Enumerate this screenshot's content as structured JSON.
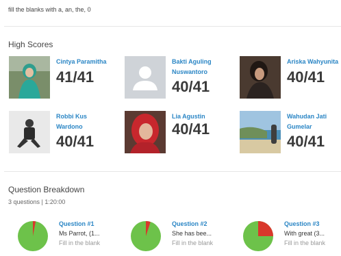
{
  "instructions": "fill the blanks with a, an, the, 0",
  "high_scores": {
    "title": "High Scores",
    "players": [
      {
        "name": "Cintya Paramitha",
        "score": "41/41",
        "avatar": "photo-girl-hijab-green-icon"
      },
      {
        "name": "Bakti Aguling\nNuswantoro",
        "score": "40/41",
        "avatar": "default-user-icon"
      },
      {
        "name": "Ariska Wahyunita",
        "score": "40/41",
        "avatar": "photo-girl-dark-icon"
      },
      {
        "name": "Robbi Kus\nWardono",
        "score": "40/41",
        "avatar": "photo-boy-sitting-icon"
      },
      {
        "name": "Lia Agustin",
        "score": "40/41",
        "avatar": "photo-girl-red-hijab-icon"
      },
      {
        "name": "Wahudan Jati\nGumelar",
        "score": "40/41",
        "avatar": "photo-beach-icon"
      }
    ]
  },
  "breakdown": {
    "title": "Question Breakdown",
    "subtitle": "3 questions | 1:20:00",
    "questions": [
      {
        "label": "Question #1",
        "text": "Ms Parrot, (1...",
        "type": "Fill in the blank",
        "correct_fraction": 0.97
      },
      {
        "label": "Question #2",
        "text": "She has bee...",
        "type": "Fill in the blank",
        "correct_fraction": 0.95
      },
      {
        "label": "Question #3",
        "text": "With great (3...",
        "type": "Fill in the blank",
        "correct_fraction": 0.75
      }
    ]
  },
  "colors": {
    "correct": "#6dc24a",
    "incorrect": "#d9382c",
    "link": "#2b86c5"
  }
}
